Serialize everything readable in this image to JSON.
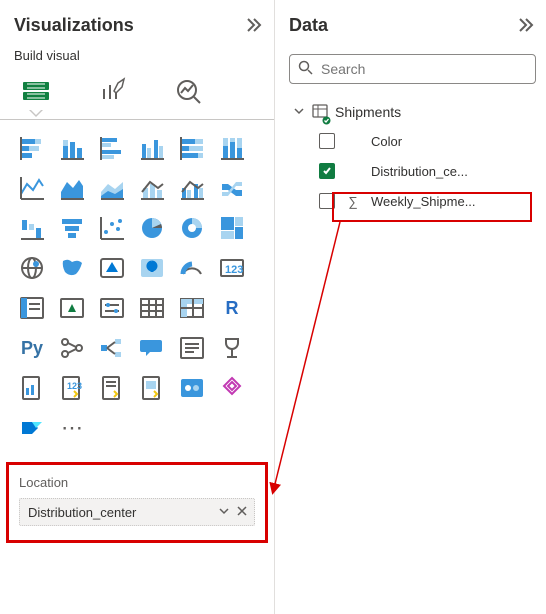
{
  "viz_pane": {
    "title": "Visualizations",
    "subtitle": "Build visual",
    "tabs": [
      "build",
      "format",
      "analytics"
    ],
    "active_tab": "build",
    "gallery": [
      "stacked-bar",
      "stacked-column",
      "clustered-bar",
      "clustered-column",
      "100-stacked-bar",
      "100-stacked-column",
      "line",
      "area",
      "stacked-area",
      "line-stacked-column",
      "line-clustered-column",
      "ribbon",
      "waterfall",
      "funnel",
      "scatter",
      "pie",
      "donut",
      "treemap",
      "map",
      "filled-map",
      "azure-map",
      "gauge",
      "card",
      "multi-row-card",
      "kpi",
      "slicer",
      "table",
      "matrix",
      "r-visual",
      "python-visual",
      "python",
      "key-influencers",
      "decomposition-tree",
      "q-and-a",
      "smart-narrative",
      "trophy",
      "paginated",
      "power-automate",
      "power-apps",
      "power-automate-2",
      "app-source",
      "get-more",
      "automate",
      "more"
    ],
    "well": {
      "label": "Location",
      "field": "Distribution_center"
    }
  },
  "data_pane": {
    "title": "Data",
    "search_placeholder": "Search",
    "table": {
      "name": "Shipments",
      "expanded": true,
      "fields": [
        {
          "name": "Color",
          "checked": false,
          "aggregate": false,
          "display": "Color"
        },
        {
          "name": "Distribution_center",
          "checked": true,
          "aggregate": false,
          "display": "Distribution_ce..."
        },
        {
          "name": "Weekly_Shipments",
          "checked": false,
          "aggregate": true,
          "display": "Weekly_Shipme..."
        }
      ]
    }
  },
  "highlight_field_index": 1
}
